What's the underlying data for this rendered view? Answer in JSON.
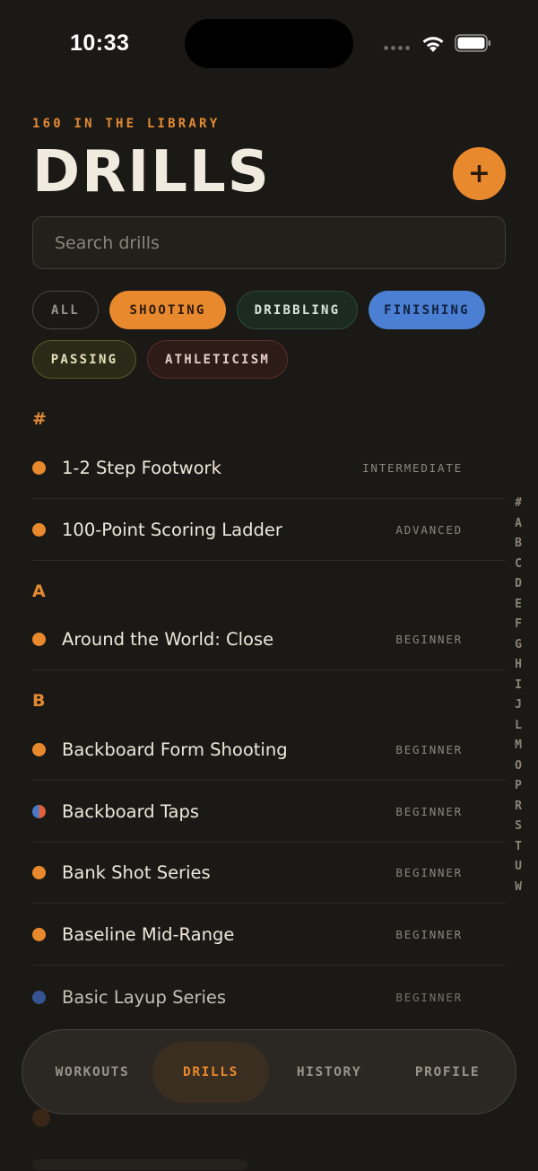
{
  "status_bar": {
    "time": "10:33"
  },
  "header": {
    "eyebrow": "160 IN THE LIBRARY",
    "title": "DRILLS",
    "add_label": "+"
  },
  "search": {
    "placeholder": "Search drills",
    "value": ""
  },
  "filters": [
    {
      "label": "ALL",
      "selected": false
    },
    {
      "label": "SHOOTING",
      "color": "#e8892e"
    },
    {
      "label": "DRIBBLING",
      "color": "#1c2b20"
    },
    {
      "label": "FINISHING",
      "color": "#4a7fd3"
    },
    {
      "label": "PASSING",
      "color": "#2a2a18"
    },
    {
      "label": "ATHLETICISM",
      "color": "#2d1b18"
    }
  ],
  "sections": [
    {
      "letter": "#",
      "drills": [
        {
          "name": "1-2 Step Footwork",
          "level": "INTERMEDIATE",
          "dot": "orange"
        },
        {
          "name": "100-Point Scoring Ladder",
          "level": "ADVANCED",
          "dot": "orange"
        }
      ]
    },
    {
      "letter": "A",
      "drills": [
        {
          "name": "Around the World: Close",
          "level": "BEGINNER",
          "dot": "orange"
        }
      ]
    },
    {
      "letter": "B",
      "drills": [
        {
          "name": "Backboard Form Shooting",
          "level": "BEGINNER",
          "dot": "orange"
        },
        {
          "name": "Backboard Taps",
          "level": "BEGINNER",
          "dot": "blue-orange"
        },
        {
          "name": "Bank Shot Series",
          "level": "BEGINNER",
          "dot": "orange"
        },
        {
          "name": "Baseline Mid-Range",
          "level": "BEGINNER",
          "dot": "orange"
        },
        {
          "name": "Basic Layup Series",
          "level": "BEGINNER",
          "dot": "blue"
        }
      ]
    }
  ],
  "alpha_index": [
    "#",
    "A",
    "B",
    "C",
    "D",
    "E",
    "F",
    "G",
    "H",
    "I",
    "J",
    "L",
    "M",
    "O",
    "P",
    "R",
    "S",
    "T",
    "U",
    "W"
  ],
  "tab_bar": {
    "tabs": [
      {
        "label": "WORKOUTS",
        "active": false
      },
      {
        "label": "DRILLS",
        "active": true
      },
      {
        "label": "HISTORY",
        "active": false
      },
      {
        "label": "PROFILE",
        "active": false
      }
    ]
  },
  "colors": {
    "accent": "#e8892e",
    "background": "#1b1916",
    "finishing": "#4a7fd3"
  }
}
